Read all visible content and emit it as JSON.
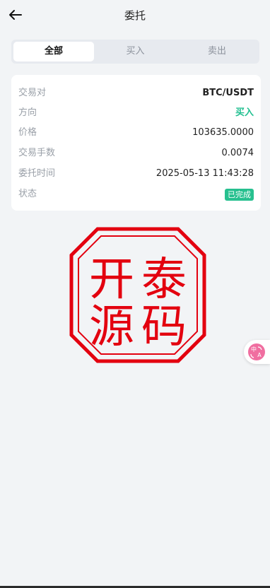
{
  "header": {
    "title": "委托"
  },
  "tabs": [
    {
      "label": "全部"
    },
    {
      "label": "买入"
    },
    {
      "label": "卖出"
    }
  ],
  "order": {
    "pair_label": "交易对",
    "pair_value": "BTC/USDT",
    "direction_label": "方向",
    "direction_value": "买入",
    "price_label": "价格",
    "price_value": "103635.0000",
    "amount_label": "交易手数",
    "amount_value": "0.0074",
    "time_label": "委托时间",
    "time_value": "2025-05-13 11:43:28",
    "status_label": "状态",
    "status_value": "已完成"
  },
  "stamp": {
    "chars": [
      "开",
      "泰",
      "源",
      "码"
    ]
  },
  "colors": {
    "accent_green": "#27c08f",
    "stamp_red": "#e3000f",
    "background": "#f2f4f6"
  },
  "icons": {
    "back": "arrow-left-icon",
    "translate": "translate-icon"
  }
}
